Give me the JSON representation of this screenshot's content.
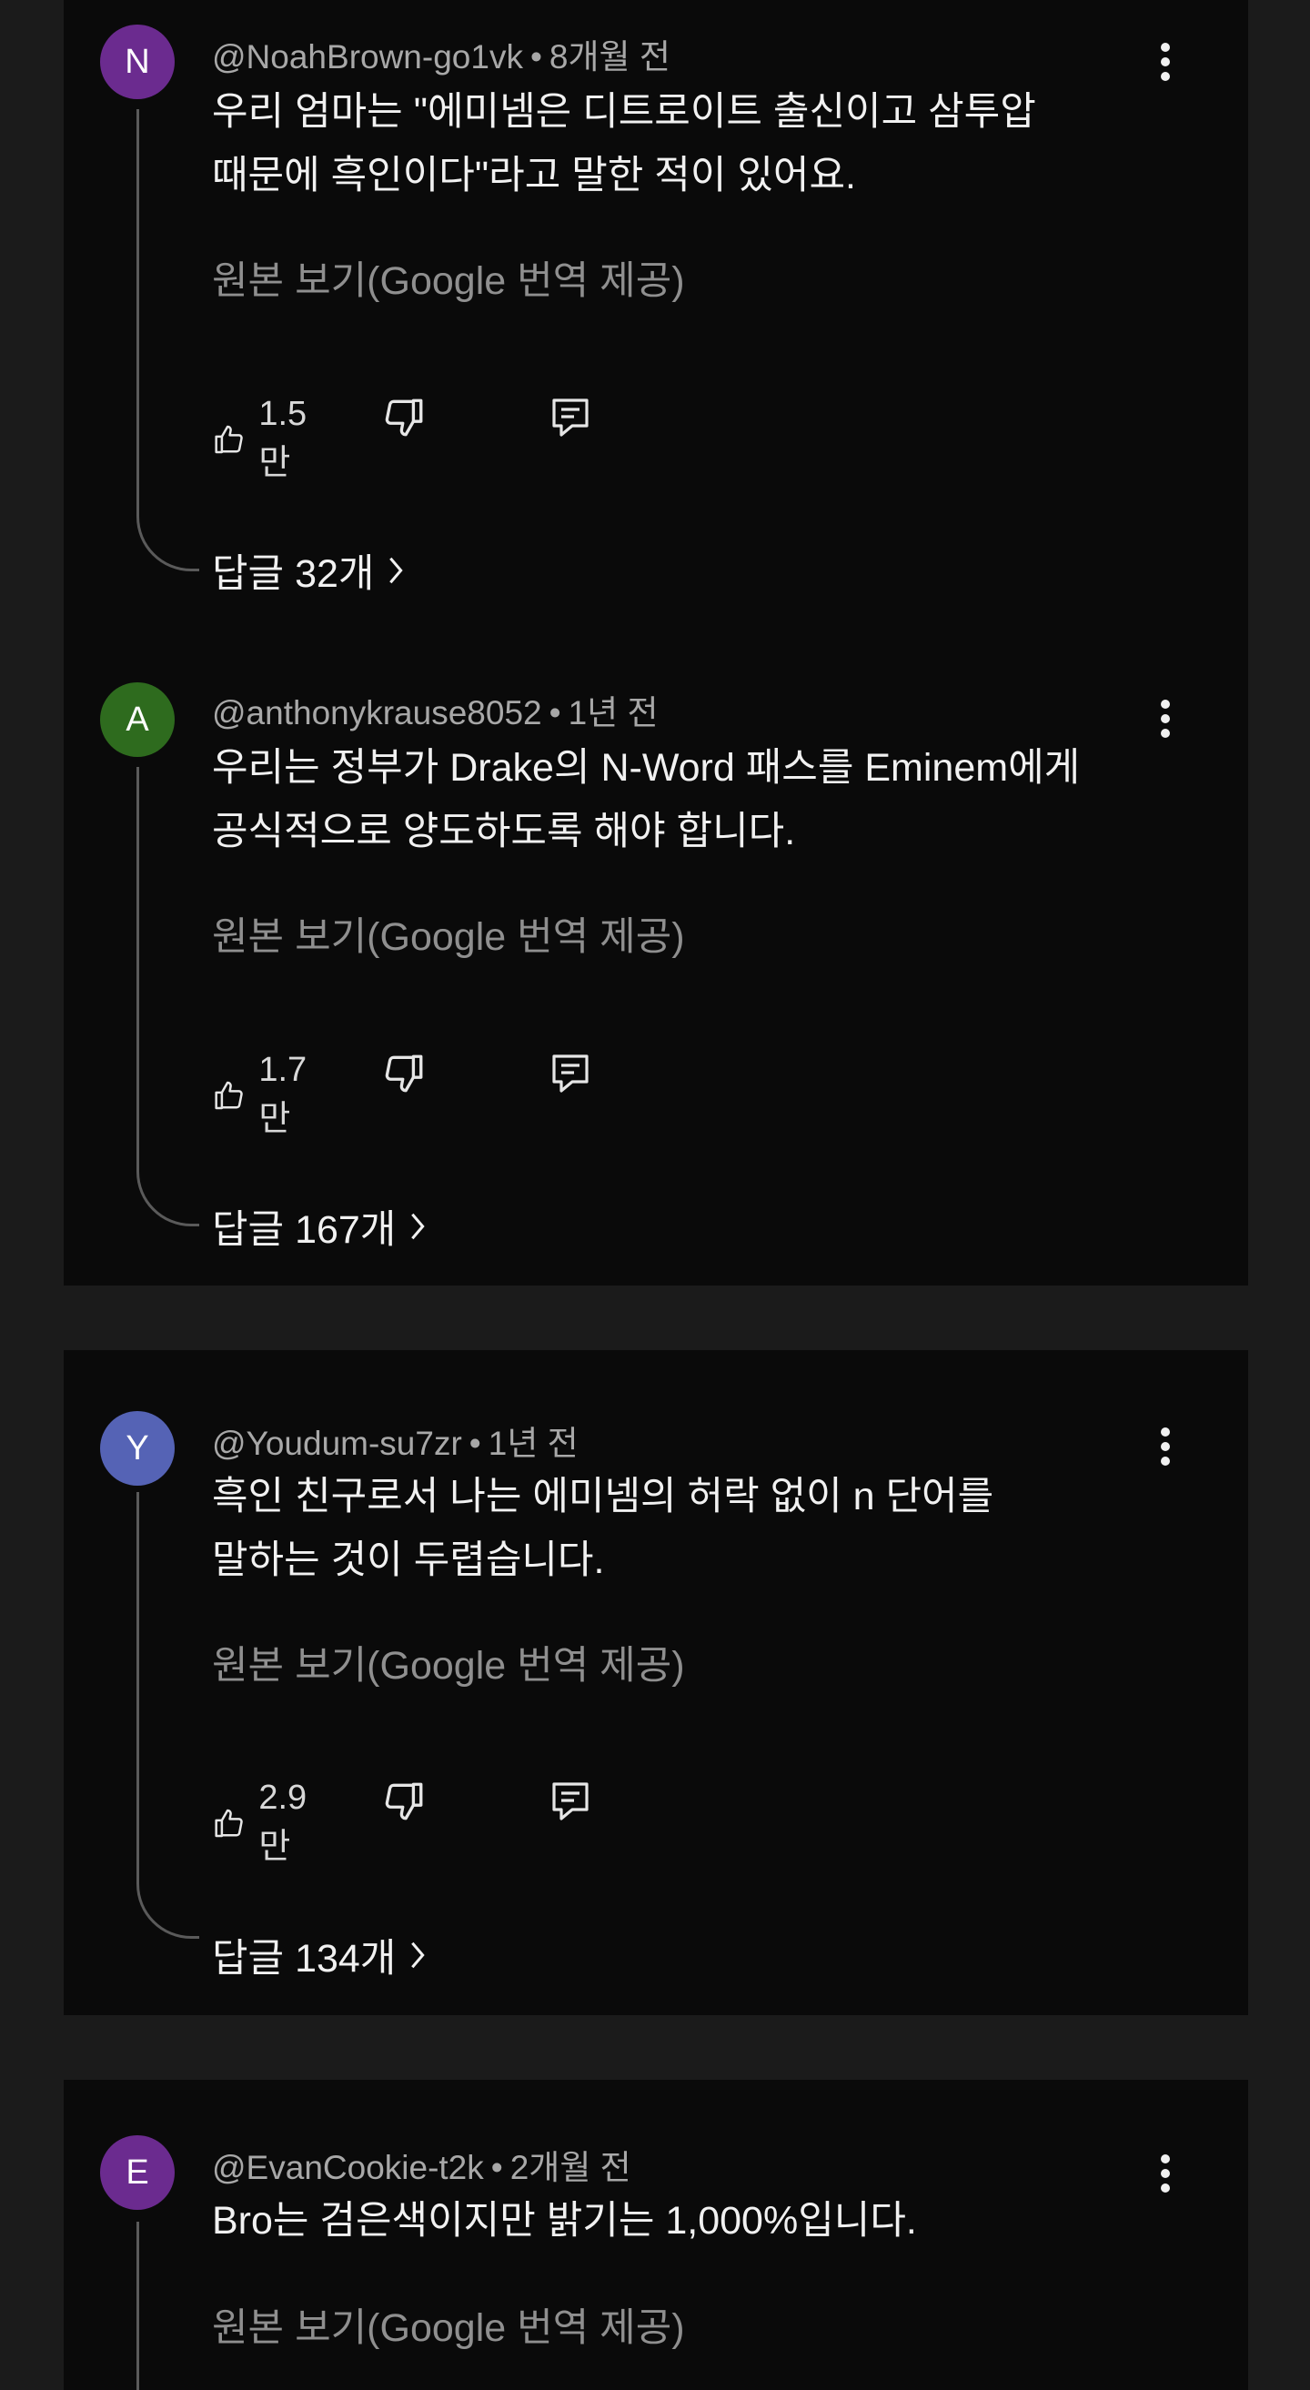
{
  "comments": [
    {
      "avatar_letter": "N",
      "avatar_color": "#6b2b8f",
      "author": "@NoahBrown-go1vk",
      "time": "8개월 전",
      "line1": "우리 엄마는 \"에미넴은 디트로이트 출신이고 삼투압",
      "line2": "때문에 흑인이다\"라고 말한 적이 있어요.",
      "translate": "원본 보기(Google 번역 제공)",
      "likes": "1.5만",
      "replies": "답글 32개"
    },
    {
      "avatar_letter": "A",
      "avatar_color": "#2e6b1e",
      "author": "@anthonykrause8052",
      "time": "1년 전",
      "line1": "우리는 정부가 Drake의 N-Word 패스를 Eminem에게",
      "line2": "공식적으로 양도하도록 해야 합니다.",
      "translate": "원본 보기(Google 번역 제공)",
      "likes": "1.7만",
      "replies": "답글 167개"
    },
    {
      "avatar_letter": "Y",
      "avatar_color": "#5563b5",
      "author": "@Youdum-su7zr",
      "time": "1년 전",
      "line1": "흑인 친구로서 나는 에미넴의 허락 없이 n 단어를",
      "line2": "말하는 것이 두렵습니다.",
      "translate": "원본 보기(Google 번역 제공)",
      "likes": "2.9만",
      "replies": "답글 134개"
    },
    {
      "avatar_letter": "E",
      "avatar_color": "#6b2b8f",
      "author": "@EvanCookie-t2k",
      "time": "2개월 전",
      "line1": "Bro는 검은색이지만 밝기는 1,000%입니다.",
      "translate": "원본 보기(Google 번역 제공)"
    }
  ],
  "separator": "•"
}
